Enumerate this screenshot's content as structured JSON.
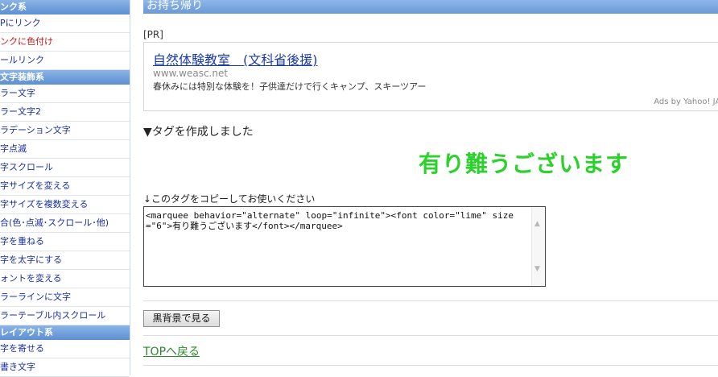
{
  "sidebar": {
    "items": [
      {
        "type": "head",
        "label": "ンク系"
      },
      {
        "type": "link",
        "label": "Pにリンク"
      },
      {
        "type": "link-red",
        "label": "ンクに色付け"
      },
      {
        "type": "link",
        "label": "ールリンク"
      },
      {
        "type": "head",
        "label": "文字装飾系"
      },
      {
        "type": "link",
        "label": "ラー文字"
      },
      {
        "type": "link",
        "label": "ラー文字2"
      },
      {
        "type": "link",
        "label": "ラデーション文字"
      },
      {
        "type": "link",
        "label": "字点滅"
      },
      {
        "type": "link",
        "label": "字スクロール"
      },
      {
        "type": "link",
        "label": "字サイズを変える"
      },
      {
        "type": "link",
        "label": "字サイズを複数変える"
      },
      {
        "type": "link",
        "label": "合(色･点滅･スクロール･他)"
      },
      {
        "type": "link",
        "label": "字を重ねる"
      },
      {
        "type": "link",
        "label": "字を太字にする"
      },
      {
        "type": "link",
        "label": "ォントを変える"
      },
      {
        "type": "link",
        "label": "ラーラインに文字"
      },
      {
        "type": "link",
        "label": "ラーテーブル内スクロール"
      },
      {
        "type": "head",
        "label": "レイアウト系"
      },
      {
        "type": "link",
        "label": "字を寄せる"
      },
      {
        "type": "link",
        "label": "書き文字"
      }
    ]
  },
  "main": {
    "section_title": "お持ち帰り",
    "pr_label": "[PR]",
    "ad": {
      "title": "自然体験教室　(文科省後援)",
      "url": "www.weasc.net",
      "description": "春休みには特別な体験を！子供達だけで行くキャンプ、スキーツアー",
      "credit": "Ads by Yahoo! JAPAN"
    },
    "created_message": "▼タグを作成しました",
    "preview_text": "有り難うございます",
    "preview_color": "#2ad22a",
    "copy_label": "↓このタグをコピーしてお使いください",
    "code_value": "<marquee behavior=\"alternate\" loop=\"infinite\"><font color=\"lime\" size=\"6\">有り難うございます</font></marquee>",
    "black_bg_button": "黒背景で見る",
    "back_link": "TOPへ戻る"
  }
}
